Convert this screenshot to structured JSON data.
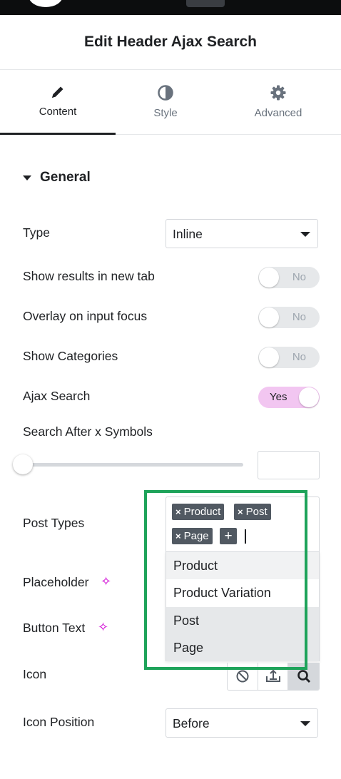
{
  "panel": {
    "title": "Edit Header Ajax Search"
  },
  "tabs": [
    {
      "label": "Content",
      "icon": "pencil-icon"
    },
    {
      "label": "Style",
      "icon": "half-circle-icon"
    },
    {
      "label": "Advanced",
      "icon": "gear-icon"
    }
  ],
  "section": {
    "title": "General"
  },
  "fields": {
    "type": {
      "label": "Type",
      "value": "Inline"
    },
    "new_tab": {
      "label": "Show results in new tab",
      "toggle": "No"
    },
    "overlay": {
      "label": "Overlay on input focus",
      "toggle": "No"
    },
    "categories": {
      "label": "Show Categories",
      "toggle": "No"
    },
    "ajax": {
      "label": "Ajax Search",
      "toggle": "Yes"
    },
    "symbols": {
      "label": "Search After x Symbols",
      "value": "",
      "slider_level": 0
    },
    "post_types": {
      "label": "Post Types",
      "tags": [
        "Product",
        "Post",
        "Page"
      ],
      "add_label": "+",
      "options": [
        "Product",
        "Product Variation",
        "Post",
        "Page"
      ]
    },
    "placeholder": {
      "label": "Placeholder"
    },
    "button_text": {
      "label": "Button Text"
    },
    "icon": {
      "label": "Icon",
      "choices": [
        "none-icon",
        "upload-icon",
        "search-icon"
      ]
    },
    "icon_position": {
      "label": "Icon Position",
      "value": "Before"
    }
  },
  "colors": {
    "accent_toggle": "#f2c6f1",
    "ai_sparkle": "#d004d4",
    "highlight_box": "#1ea35a"
  }
}
